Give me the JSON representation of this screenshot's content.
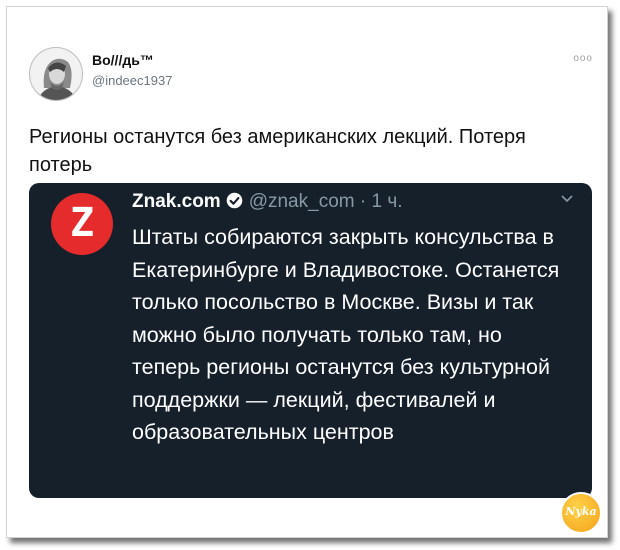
{
  "tweet": {
    "author_name": "Во///дь™",
    "author_handle": "@indeec1937",
    "more_icon": "more-dots-icon",
    "text": "Регионы останутся без американских лекций. Потеря потерь"
  },
  "quote": {
    "logo_letter": "Z",
    "name": "Znak.com",
    "handle": "@znak_com",
    "separator": "·",
    "time": "1 ч.",
    "text": "Штаты собираются закрыть консульства в Екатеринбурге и Владивостоке. Останется только посольство в Москве. Визы и так можно было получать только там, но теперь регионы останутся без культурной поддержки — лекций, фестивалей и образовательных центров",
    "colors": {
      "background": "#15202b",
      "logo": "#e52b2b",
      "verified": "#1da1f2"
    }
  },
  "watermark": {
    "text": "Nyka"
  }
}
